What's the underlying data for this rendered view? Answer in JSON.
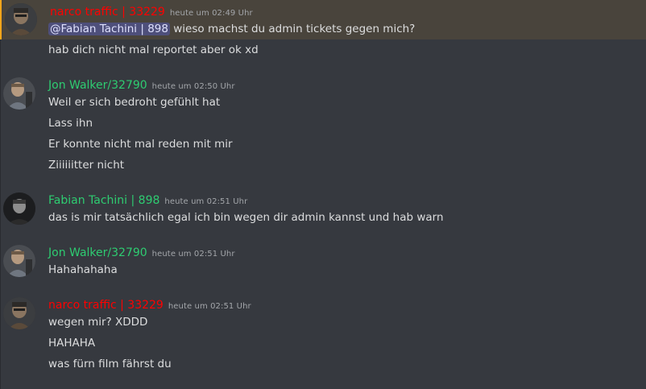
{
  "colors": {
    "background": "#36393f",
    "highlight_background": "#49443c",
    "narco_name": "#ff0000",
    "green_name": "#2ecc71",
    "message_text": "#dcddde",
    "timestamp": "#a3a6aa"
  },
  "groups": [
    {
      "author": "narco traffic | 33229",
      "timestamp": "heute um 02:49 Uhr",
      "avatar_icon": "character-avatar-icon",
      "mention": "@Fabian Tachini | 898",
      "lines": [
        "wieso machst du admin tickets gegen mich?",
        "hab dich nicht mal reportet aber ok xd"
      ]
    },
    {
      "author": "Jon Walker/32790",
      "timestamp": "heute um 02:50 Uhr",
      "avatar_icon": "character-avatar-icon",
      "lines": [
        "Weil er sich bedroht gefühlt hat",
        "Lass ihn",
        "Er konnte nicht mal reden mit mir",
        "Ziiiiiitter nicht"
      ]
    },
    {
      "author": "Fabian Tachini | 898",
      "timestamp": "heute um 02:51 Uhr",
      "avatar_icon": "character-avatar-icon",
      "lines": [
        "das is mir tatsächlich egal ich bin wegen dir admin kannst und hab warn"
      ]
    },
    {
      "author": "Jon Walker/32790",
      "timestamp": "heute um 02:51 Uhr",
      "avatar_icon": "character-avatar-icon",
      "lines": [
        "Hahahahaha"
      ]
    },
    {
      "author": "narco traffic | 33229",
      "timestamp": "heute um 02:51 Uhr",
      "avatar_icon": "character-avatar-icon",
      "lines": [
        "wegen mir? XDDD",
        "HAHAHA",
        "was fürn film fährst du"
      ]
    }
  ]
}
